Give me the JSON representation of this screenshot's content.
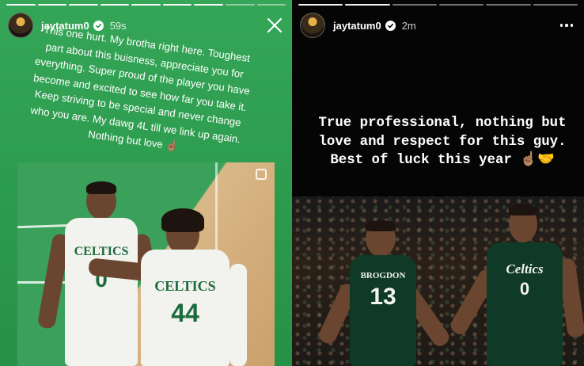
{
  "stories": [
    {
      "id_label": "left",
      "username": "jaytatum0",
      "time": "59s",
      "progress": {
        "total": 9,
        "done": 7
      },
      "caption": "This one hurt. My brotha right here. Toughest part about this buisness, appreciate you for everything. Super proud of the player you have become and excited to see how far you take it. Keep striving to be special and never change who you are. My dawg 4L till we link up again. Nothing but love ☝🏽",
      "photo": {
        "players": [
          {
            "team": "CELTICS",
            "number": "0"
          },
          {
            "team": "CELTICS",
            "number": "44"
          }
        ]
      }
    },
    {
      "id_label": "right",
      "username": "jaytatum0",
      "time": "2m",
      "progress": {
        "total": 6,
        "done": 2
      },
      "caption": "True professional, nothing but love and respect for this guy. Best of luck this year ☝🏽🤝",
      "photo": {
        "players": [
          {
            "team": "BROGDON",
            "number": "13"
          },
          {
            "team": "Celtics",
            "number": "0"
          }
        ]
      }
    }
  ],
  "colors": {
    "left_bg": "#2e9a4f",
    "right_bg": "#050505",
    "jersey_white": "#f2f2ee",
    "jersey_green": "#0f3a27",
    "celtics_green": "#1c6b3c"
  },
  "icons": {
    "left_action": "close-icon",
    "right_action": "more-horizontal-icon",
    "badge": "verified-badge-icon"
  }
}
